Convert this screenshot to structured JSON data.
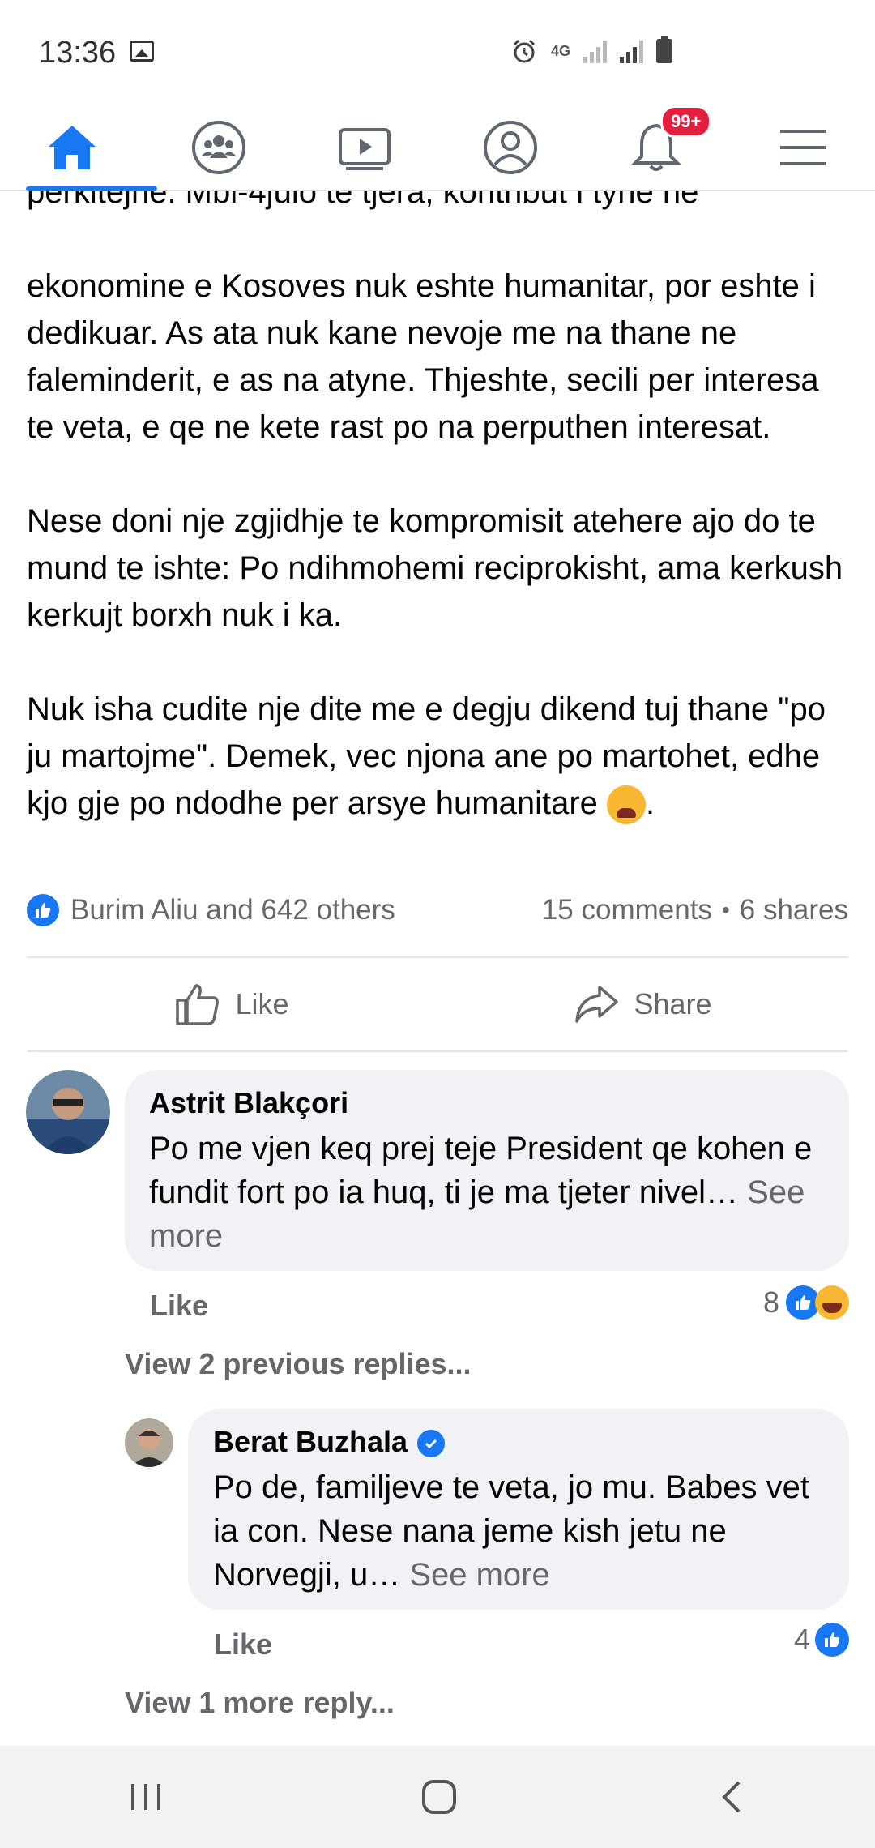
{
  "status_bar": {
    "time": "13:36",
    "network": "4G"
  },
  "nav": {
    "tabs": [
      {
        "name": "home",
        "active": true
      },
      {
        "name": "groups"
      },
      {
        "name": "watch"
      },
      {
        "name": "profile"
      },
      {
        "name": "notifications",
        "badge": "99+"
      },
      {
        "name": "menu"
      }
    ],
    "accent": "#1877f2",
    "badge_color": "#e41e3f"
  },
  "post": {
    "paragraphs": [
      "ekonomine e Kosoves nuk eshte humanitar, por eshte i dedikuar. As ata nuk kane nevoje me na thane ne faleminderit, e as na atyne. Thjeshte, secili per interesa te veta, e qe ne kete rast po na perputhen interesat.",
      "Nese doni nje zgjidhje te kompromisit atehere ajo do te mund te ishte: Po ndihmohemi reciprokisht, ama kerkush kerkujt borxh nuk i ka.",
      "Nuk isha cudite nje dite me e degju dikend tuj thane \"po ju martojme\". Demek, vec njona ane po martohet, edhe kjo gje po ndodhe per arsye humanitare"
    ],
    "end_punct": ".",
    "reactions_summary": "Burim Aliu and 642 others",
    "comments_count": "15 comments",
    "separator": "•",
    "shares_count": "6 shares",
    "like_label": "Like",
    "share_label": "Share"
  },
  "comments": [
    {
      "author": "Astrit Blakçori",
      "text": "Po me vjen keq prej teje President qe kohen e fundit fort po ia huq, ti je ma tjeter nivel…",
      "see_more": "See more",
      "like_label": "Like",
      "reaction_count": "8"
    },
    {
      "view_previous": "View 2 previous replies..."
    },
    {
      "author": "Berat Buzhala",
      "verified": true,
      "text": "Po de, familjeve te veta, jo mu. Babes vet ia con. Nese nana jeme kish jetu ne Norvegji, u…",
      "see_more": "See more",
      "like_label": "Like",
      "reaction_count": "4"
    },
    {
      "view_more": "View 1 more reply..."
    }
  ]
}
